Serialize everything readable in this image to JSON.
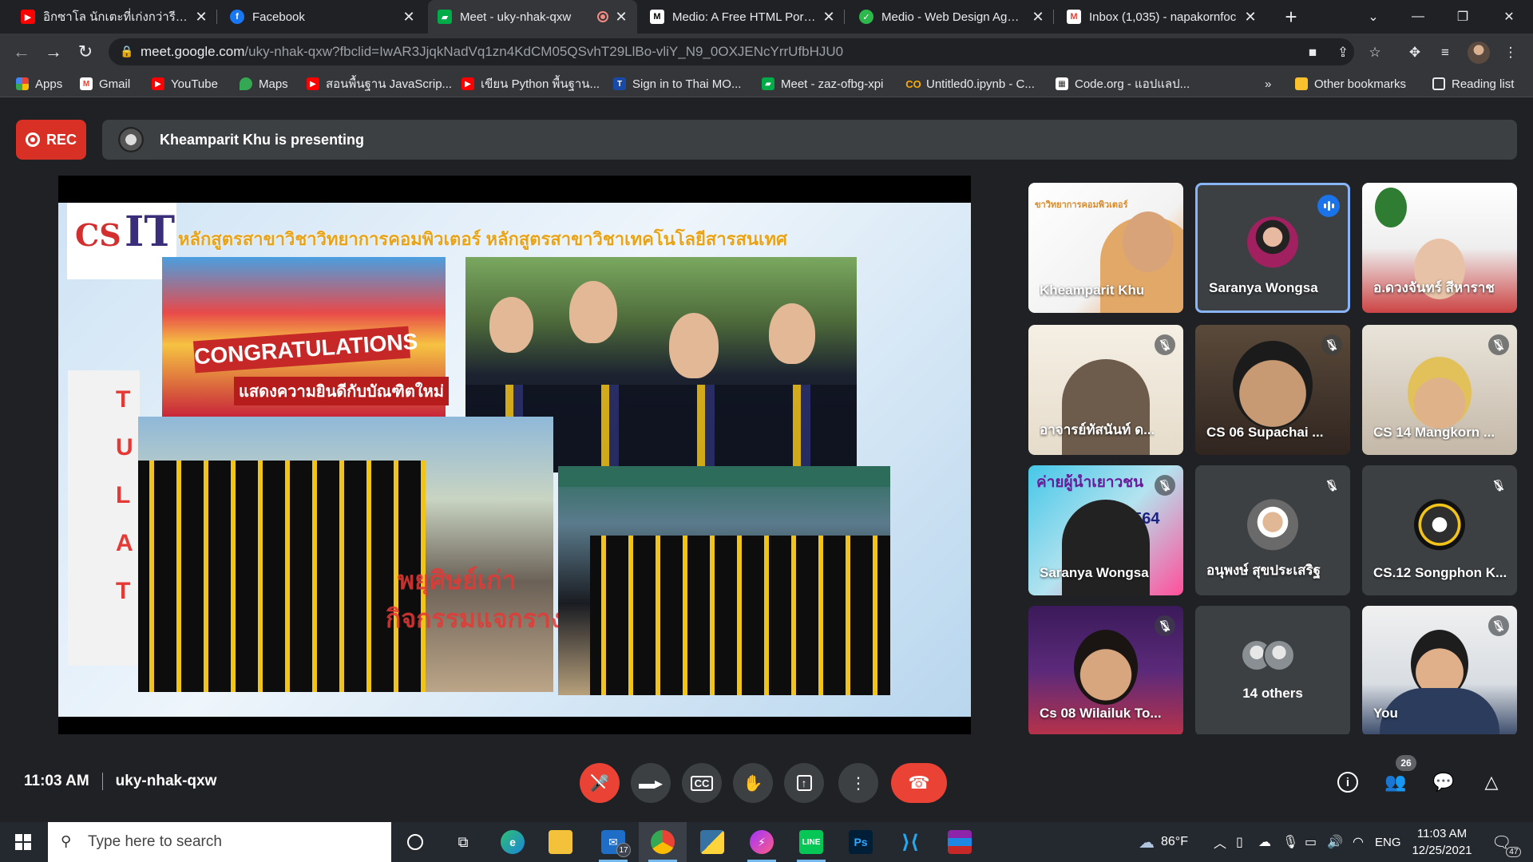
{
  "browser": {
    "tabs": [
      {
        "label": "อิกซาโล นักเตะที่เก่งกว่ารีโมทไพ",
        "icon": "youtube-icon",
        "color": "#ff0000"
      },
      {
        "label": "Facebook",
        "icon": "facebook-icon",
        "color": "#1877f2"
      },
      {
        "label": "Meet - uky-nhak-qxw",
        "icon": "meet-icon",
        "color": "#00ac47",
        "active": true
      },
      {
        "label": "Medio: A Free HTML Portfol",
        "icon": "medio-icon",
        "color": "#ffffff"
      },
      {
        "label": "Medio - Web Design Agenc",
        "icon": "medio-green-icon",
        "color": "#2db84b"
      },
      {
        "label": "Inbox (1,035) - napakornfoc",
        "icon": "gmail-icon",
        "color": "#ea4335"
      }
    ],
    "url_host": "meet.google.com",
    "url_path": "/uky-nhak-qxw?fbclid=IwAR3JjqkNadVq1zn4KdCM05QSvhT29LlBo-vliY_N9_0OXJENcYrrUfbHJU0",
    "bookmarks": [
      {
        "label": "Apps",
        "icon": "apps-grid-icon",
        "color": "#4285f4"
      },
      {
        "label": "Gmail",
        "icon": "gmail-icon",
        "color": "#ea4335"
      },
      {
        "label": "YouTube",
        "icon": "youtube-icon",
        "color": "#ff0000"
      },
      {
        "label": "Maps",
        "icon": "maps-icon",
        "color": "#34a853"
      },
      {
        "label": "สอนพื้นฐาน JavaScrip...",
        "icon": "youtube-icon",
        "color": "#ff0000"
      },
      {
        "label": "เขียน Python พื้นฐาน...",
        "icon": "youtube-icon",
        "color": "#ff0000"
      },
      {
        "label": "Sign in to Thai MO...",
        "icon": "thaimooc-icon",
        "color": "#1a4aa8"
      },
      {
        "label": "Meet - zaz-ofbg-xpi",
        "icon": "meet-icon",
        "color": "#00ac47"
      },
      {
        "label": "Untitled0.ipynb - C...",
        "icon": "colab-icon",
        "color": "#f9ab00"
      },
      {
        "label": "Code.org - แอปแลป...",
        "icon": "codeorg-icon",
        "color": "#ffffff"
      }
    ],
    "bookmarks_overflow": "»",
    "other_bookmarks": "Other bookmarks",
    "reading_list": "Reading list"
  },
  "meet": {
    "rec_label": "REC",
    "presenting_text": "Kheamparit Khu is presenting",
    "slide": {
      "title": "หลักสูตรสาขาวิชาวิทยาการคอมพิวเตอร์   หลักสูตรสาขาวิชาเทคโนโลยีสารสนเทศ",
      "logo_cs": "CS",
      "logo_it": "IT",
      "banner": "CONGRATULATIONS",
      "banner_sub": "แสดงความยินดีกับบัณฑิตใหม่",
      "caption_1": "พยุศิษย์เก่า",
      "caption_2": "กิจกรรมแจกรางวัล"
    },
    "participants": [
      {
        "name": "Kheamparit Khu",
        "muted": false,
        "speaking": false
      },
      {
        "name": "Saranya Wongsa",
        "muted": false,
        "speaking": true
      },
      {
        "name": "อ.ดวงจันทร์ สีหาราช",
        "muted": false,
        "speaking": false
      },
      {
        "name": "อาจารย์ทัสนันท์ ด...",
        "muted": true,
        "speaking": false
      },
      {
        "name": "CS 06 Supachai ...",
        "muted": true,
        "speaking": false
      },
      {
        "name": "CS 14 Mangkorn ...",
        "muted": true,
        "speaking": false
      },
      {
        "name": "Saranya Wongsa",
        "muted": true,
        "speaking": false
      },
      {
        "name": "อนุพงษ์ สุขประเสริฐ",
        "muted": true,
        "speaking": false
      },
      {
        "name": "CS.12 Songphon K...",
        "muted": true,
        "speaking": false
      },
      {
        "name": "Cs 08 Wilailuk To...",
        "muted": true,
        "speaking": false
      },
      {
        "name": "14 others",
        "muted": false,
        "speaking": false
      },
      {
        "name": "You",
        "muted": true,
        "speaking": false
      }
    ],
    "time": "11:03 AM",
    "meeting_code": "uky-nhak-qxw",
    "people_count": "26"
  },
  "taskbar": {
    "search_placeholder": "Type here to search",
    "mail_badge": "17",
    "weather": "86°F",
    "language": "ENG",
    "clock_time": "11:03 AM",
    "clock_date": "12/25/2021",
    "notif_count": "47"
  }
}
